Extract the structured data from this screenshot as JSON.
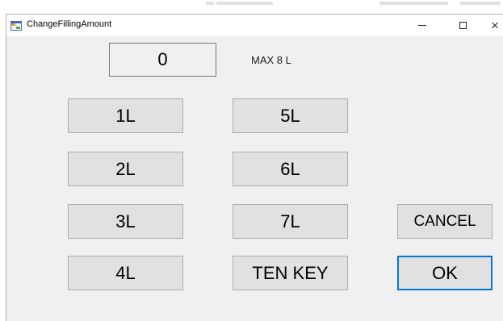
{
  "window": {
    "title": "ChangeFillingAmount",
    "controls": {
      "minimize": "minimize",
      "maximize": "maximize",
      "close": "×"
    }
  },
  "display": {
    "amount": "0",
    "max_label": "MAX 8 L"
  },
  "buttons": {
    "b1": "1L",
    "b2": "2L",
    "b3": "3L",
    "b4": "4L",
    "b5": "5L",
    "b6": "6L",
    "b7": "7L",
    "ten_key": "TEN KEY",
    "cancel": "CANCEL",
    "ok": "OK"
  },
  "colors": {
    "window_bg": "#f0f0f0",
    "button_bg": "#e1e1e1",
    "button_border": "#adadad",
    "focus_border": "#0078d7"
  }
}
